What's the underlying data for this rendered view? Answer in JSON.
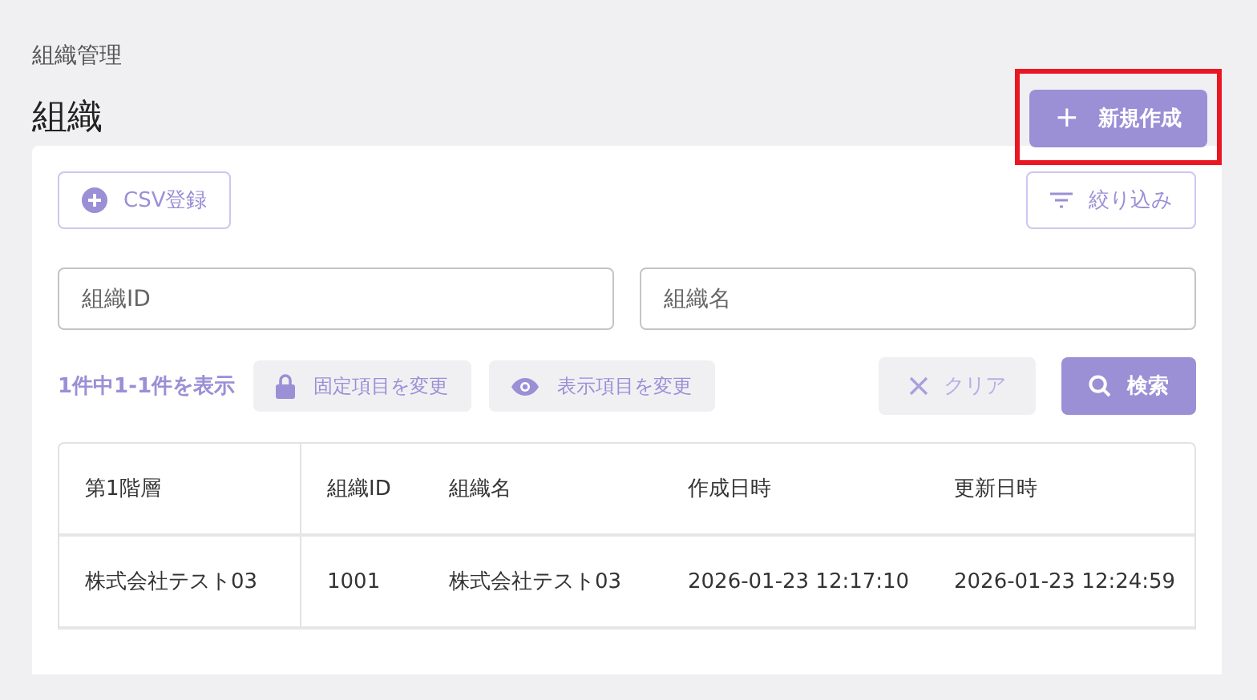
{
  "breadcrumb": "組織管理",
  "title": "組織",
  "create_button": {
    "icon": "+",
    "label": "新規作成",
    "highlighted": true
  },
  "toolbar": {
    "csv_button": "CSV登録",
    "filter_button": "絞り込み"
  },
  "search_fields": [
    {
      "placeholder": "組織ID"
    },
    {
      "placeholder": "組織名"
    }
  ],
  "result_count": "1件中1-1件を表示",
  "actions": [
    {
      "kind": "lock",
      "label": "固定項目を変更"
    },
    {
      "kind": "eye",
      "label": "表示項目を変更"
    }
  ],
  "clear_button": {
    "label": "クリア",
    "disabled": true
  },
  "search_button": "検索",
  "table": {
    "columns": [
      "第1階層",
      "組織ID",
      "組織名",
      "作成日時",
      "更新日時"
    ],
    "rows": [
      [
        "株式会社テスト03",
        "1001",
        "株式会社テスト03",
        "2026-01-23 12:17:10",
        "2026-01-23 12:24:59"
      ]
    ]
  }
}
